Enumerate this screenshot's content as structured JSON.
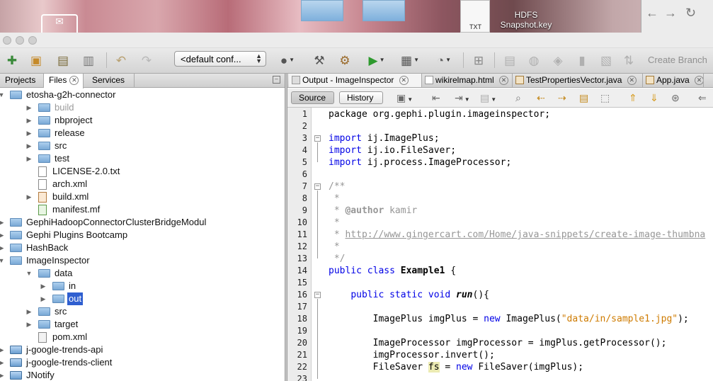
{
  "desktop": {
    "file_icon_caption": "TXT",
    "file_name_line1": "HDFS",
    "file_name_line2": "Snapshot.key",
    "browser_buttons": [
      "back-arrow",
      "forward-arrow",
      "reload"
    ]
  },
  "toolbar": {
    "config_label": "<default conf...",
    "create_branch_label": "Create Branch",
    "icons": [
      "new-file-icon",
      "new-project-icon",
      "open-project-icon",
      "close-project-icon",
      "undo-icon",
      "redo-icon",
      "globe-icon",
      "build-hammer-icon",
      "clean-build-icon",
      "run-icon",
      "debug-icon",
      "profile-icon",
      "layout-icon"
    ]
  },
  "left_panel": {
    "tabs": [
      {
        "label": "Projects",
        "active": false
      },
      {
        "label": "Files",
        "active": true
      },
      {
        "label": "Services",
        "active": false
      }
    ],
    "tree": [
      {
        "label": "etosha-g2h-connector",
        "type": "folder",
        "depth": 0,
        "expanded": true
      },
      {
        "label": "build",
        "type": "folder",
        "depth": 1,
        "expanded": false,
        "dim": true
      },
      {
        "label": "nbproject",
        "type": "folder",
        "depth": 1,
        "expanded": false
      },
      {
        "label": "release",
        "type": "folder",
        "depth": 1,
        "expanded": false
      },
      {
        "label": "src",
        "type": "folder",
        "depth": 1,
        "expanded": false
      },
      {
        "label": "test",
        "type": "folder",
        "depth": 1,
        "expanded": false
      },
      {
        "label": "LICENSE-2.0.txt",
        "type": "file",
        "depth": 1
      },
      {
        "label": "arch.xml",
        "type": "file",
        "depth": 1
      },
      {
        "label": "build.xml",
        "type": "xml",
        "depth": 1,
        "expanded": false
      },
      {
        "label": "manifest.mf",
        "type": "mf",
        "depth": 1
      },
      {
        "label": "GephiHadoopConnectorClusterBridgeModul",
        "type": "folder",
        "depth": 0,
        "expanded": false
      },
      {
        "label": "Gephi Plugins Bootcamp",
        "type": "folder",
        "depth": 0,
        "expanded": false
      },
      {
        "label": "HashBack",
        "type": "folder",
        "depth": 0,
        "expanded": false
      },
      {
        "label": "ImageInspector",
        "type": "folder",
        "depth": 0,
        "expanded": true
      },
      {
        "label": "data",
        "type": "folder",
        "depth": 1,
        "expanded": true
      },
      {
        "label": "in",
        "type": "folder",
        "depth": 2,
        "expanded": false
      },
      {
        "label": "out",
        "type": "folder",
        "depth": 2,
        "expanded": false,
        "selected": true
      },
      {
        "label": "src",
        "type": "folder",
        "depth": 1,
        "expanded": false
      },
      {
        "label": "target",
        "type": "folder",
        "depth": 1,
        "expanded": false
      },
      {
        "label": "pom.xml",
        "type": "pom",
        "depth": 1
      },
      {
        "label": "j-google-trends-api",
        "type": "module",
        "depth": 0,
        "expanded": false
      },
      {
        "label": "j-google-trends-client",
        "type": "module",
        "depth": 0,
        "expanded": false
      },
      {
        "label": "JNotify",
        "type": "module",
        "depth": 0,
        "expanded": false
      }
    ]
  },
  "editor": {
    "tabs": [
      {
        "label": "Output - ImageInspector",
        "active": true
      },
      {
        "label": "wikirelmap.html",
        "active": false
      },
      {
        "label": "TestPropertiesVector.java",
        "active": false
      },
      {
        "label": "App.java",
        "active": false
      }
    ],
    "view_buttons": [
      {
        "label": "Source",
        "active": true
      },
      {
        "label": "History",
        "active": false
      }
    ],
    "lines": [
      {
        "n": "1",
        "parts": [
          {
            "t": "package org.gephi.plugin.imageinspector;",
            "c": ""
          }
        ]
      },
      {
        "n": "2",
        "parts": []
      },
      {
        "n": "3",
        "parts": [
          {
            "t": "import",
            "c": "kw"
          },
          {
            "t": " ij.ImagePlus;",
            "c": ""
          }
        ]
      },
      {
        "n": "4",
        "parts": [
          {
            "t": "import",
            "c": "kw"
          },
          {
            "t": " ij.io.FileSaver;",
            "c": ""
          }
        ]
      },
      {
        "n": "5",
        "parts": [
          {
            "t": "import",
            "c": "kw"
          },
          {
            "t": " ij.process.ImageProcessor;",
            "c": ""
          }
        ]
      },
      {
        "n": "6",
        "parts": []
      },
      {
        "n": "7",
        "parts": [
          {
            "t": "/**",
            "c": "cm"
          }
        ]
      },
      {
        "n": "8",
        "parts": [
          {
            "t": " *",
            "c": "cm"
          }
        ]
      },
      {
        "n": "9",
        "parts": [
          {
            "t": " * ",
            "c": "cm"
          },
          {
            "t": "@author",
            "c": "cm bd"
          },
          {
            "t": " kamir",
            "c": "cm"
          }
        ]
      },
      {
        "n": "10",
        "parts": [
          {
            "t": " *",
            "c": "cm"
          }
        ]
      },
      {
        "n": "11",
        "parts": [
          {
            "t": " * ",
            "c": "cm"
          },
          {
            "t": "http://www.gingercart.com/Home/java-snippets/create-image-thumbna",
            "c": "lk"
          }
        ]
      },
      {
        "n": "12",
        "parts": [
          {
            "t": " *",
            "c": "cm"
          }
        ]
      },
      {
        "n": "13",
        "parts": [
          {
            "t": " */",
            "c": "cm"
          }
        ]
      },
      {
        "n": "14",
        "parts": [
          {
            "t": "public class ",
            "c": "kw"
          },
          {
            "t": "Example1",
            "c": "bd"
          },
          {
            "t": " {",
            "c": ""
          }
        ]
      },
      {
        "n": "15",
        "parts": []
      },
      {
        "n": "16",
        "parts": [
          {
            "t": "    ",
            "c": ""
          },
          {
            "t": "public static void ",
            "c": "kw"
          },
          {
            "t": "run",
            "c": "it"
          },
          {
            "t": "(){",
            "c": ""
          }
        ]
      },
      {
        "n": "17",
        "parts": []
      },
      {
        "n": "18",
        "parts": [
          {
            "t": "        ImagePlus imgPlus = ",
            "c": ""
          },
          {
            "t": "new",
            "c": "kw"
          },
          {
            "t": " ImagePlus(",
            "c": ""
          },
          {
            "t": "\"data/in/sample1.jpg\"",
            "c": "str"
          },
          {
            "t": ");",
            "c": ""
          }
        ]
      },
      {
        "n": "19",
        "parts": []
      },
      {
        "n": "20",
        "parts": [
          {
            "t": "        ImageProcessor imgProcessor = imgPlus.getProcessor();",
            "c": ""
          }
        ]
      },
      {
        "n": "21",
        "parts": [
          {
            "t": "        imgProcessor.invert();",
            "c": ""
          }
        ]
      },
      {
        "n": "22",
        "parts": [
          {
            "t": "        FileSaver ",
            "c": ""
          },
          {
            "t": "fs",
            "c": "hl"
          },
          {
            "t": " = ",
            "c": ""
          },
          {
            "t": "new",
            "c": "kw"
          },
          {
            "t": " FileSaver(imgPlus);",
            "c": ""
          }
        ]
      },
      {
        "n": "23",
        "parts": []
      }
    ]
  }
}
